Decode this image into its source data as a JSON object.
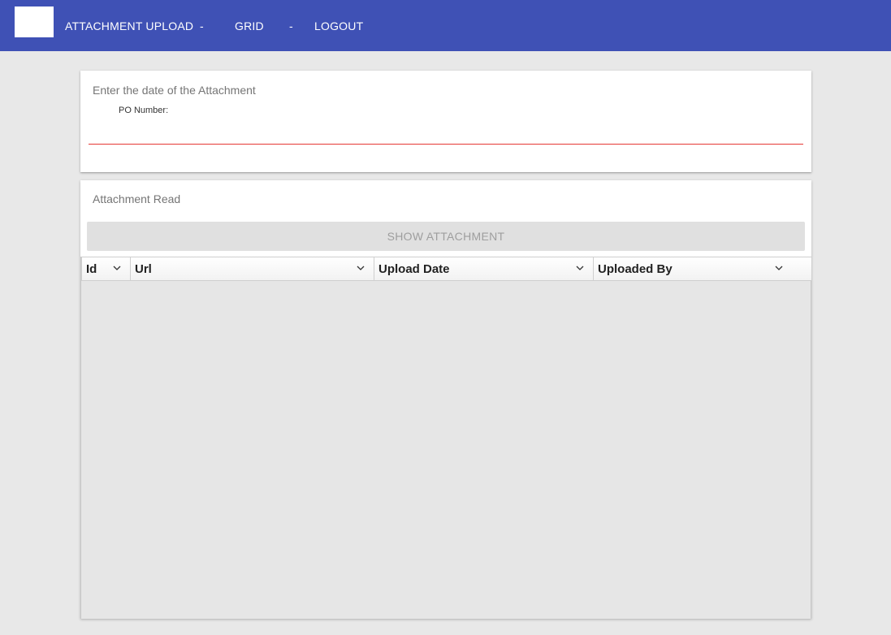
{
  "nav": {
    "links": [
      "ATTACHMENT UPLOAD",
      "GRID",
      "LOGOUT"
    ],
    "separator": "-",
    "bar_color": "#3f51b5"
  },
  "date_card": {
    "title": "Enter the date of the Attachment",
    "po_label": "PO Number:",
    "po_value": "",
    "underline_color": "#e53935"
  },
  "read_card": {
    "title": "Attachment Read",
    "button_label": "SHOW ATTACHMENT"
  },
  "grid": {
    "columns": [
      "Id",
      "Url",
      "Upload Date",
      "Uploaded By"
    ],
    "rows": []
  }
}
